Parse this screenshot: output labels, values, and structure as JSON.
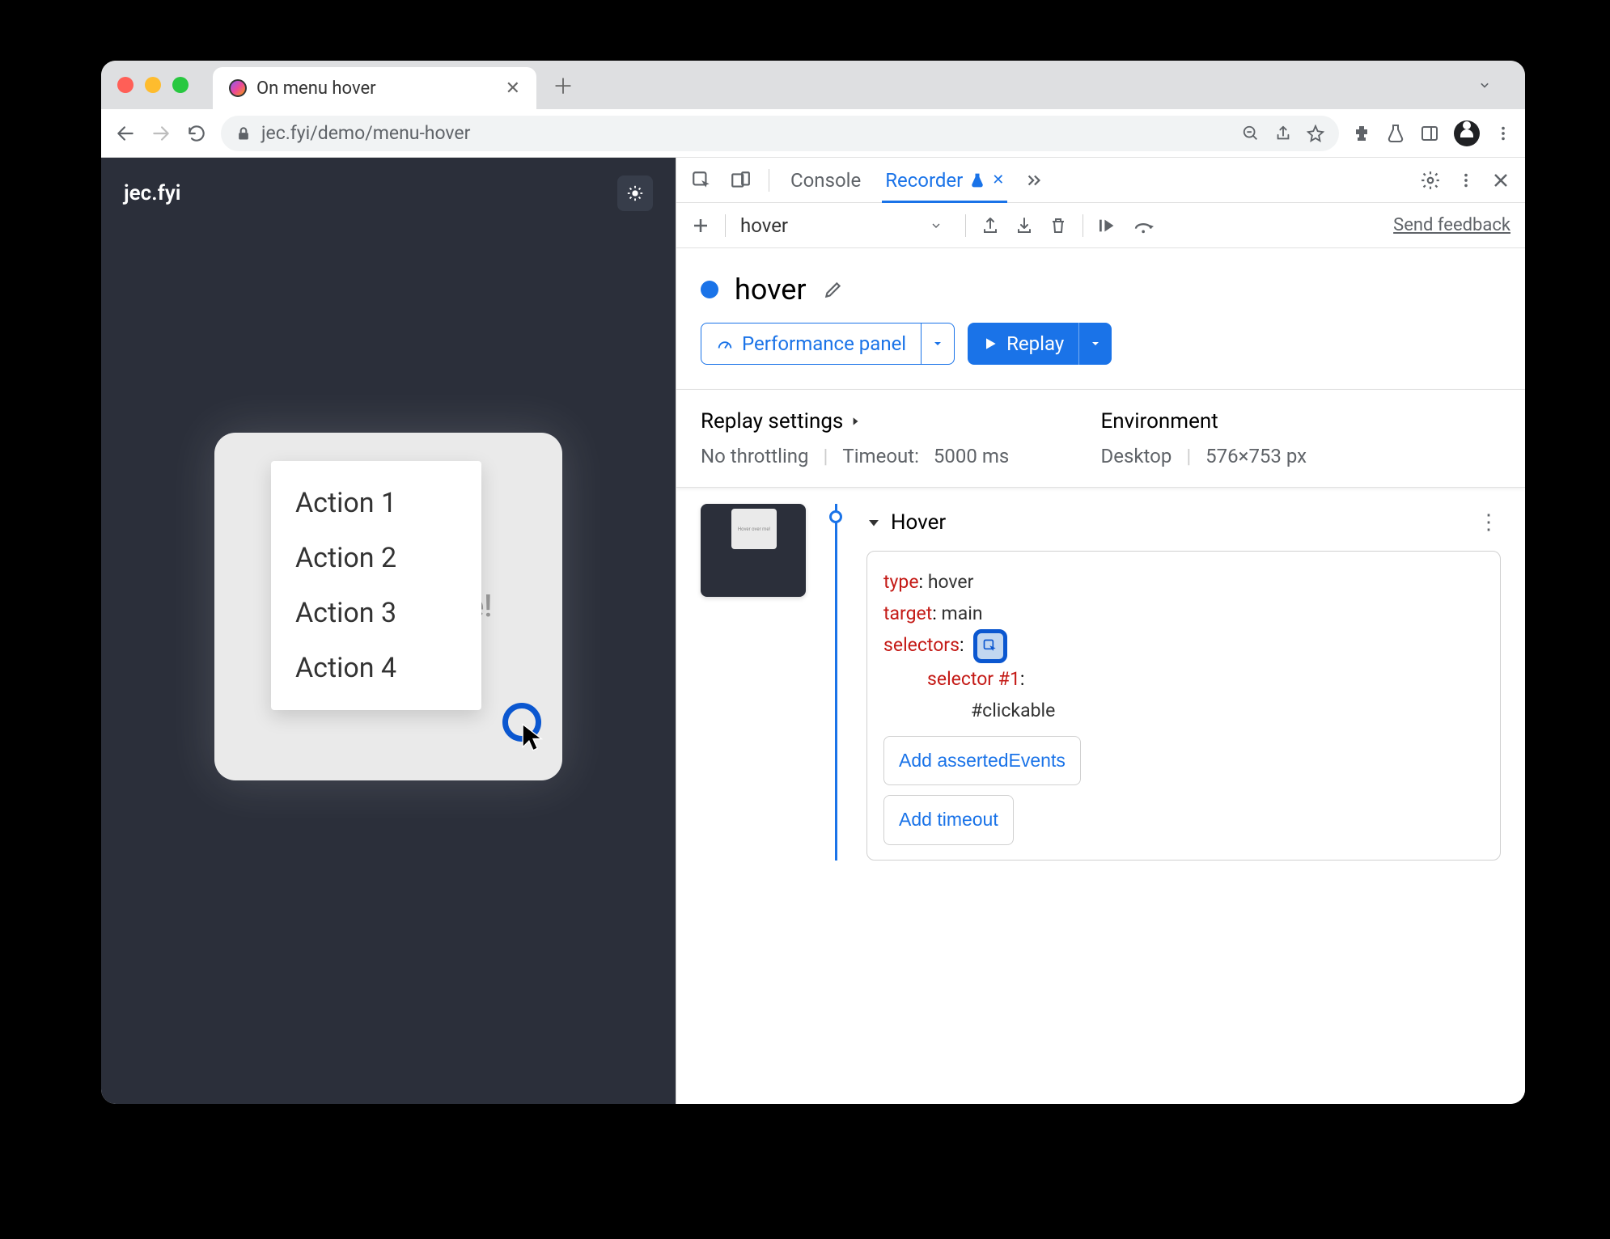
{
  "browser": {
    "tab_title": "On menu hover",
    "url": "jec.fyi/demo/menu-hover"
  },
  "page": {
    "site_title": "jec.fyi",
    "card_text": "Hover over me!",
    "menu_items": [
      "Action 1",
      "Action 2",
      "Action 3",
      "Action 4"
    ]
  },
  "devtools": {
    "tabs": {
      "console": "Console",
      "recorder": "Recorder"
    },
    "dropdown_value": "hover",
    "feedback": "Send feedback",
    "recording_name": "hover",
    "perf_button": "Performance panel",
    "replay_button": "Replay",
    "replay_settings_label": "Replay settings",
    "throttling": "No throttling",
    "timeout_label": "Timeout:",
    "timeout_value": "5000 ms",
    "environment_label": "Environment",
    "env_device": "Desktop",
    "env_viewport": "576×753 px",
    "step": {
      "name": "Hover",
      "type_key": "type",
      "type_val": "hover",
      "target_key": "target",
      "target_val": "main",
      "selectors_key": "selectors",
      "selector_label": "selector #1",
      "selector_val": "#clickable",
      "add_asserted": "Add assertedEvents",
      "add_timeout": "Add timeout"
    }
  }
}
